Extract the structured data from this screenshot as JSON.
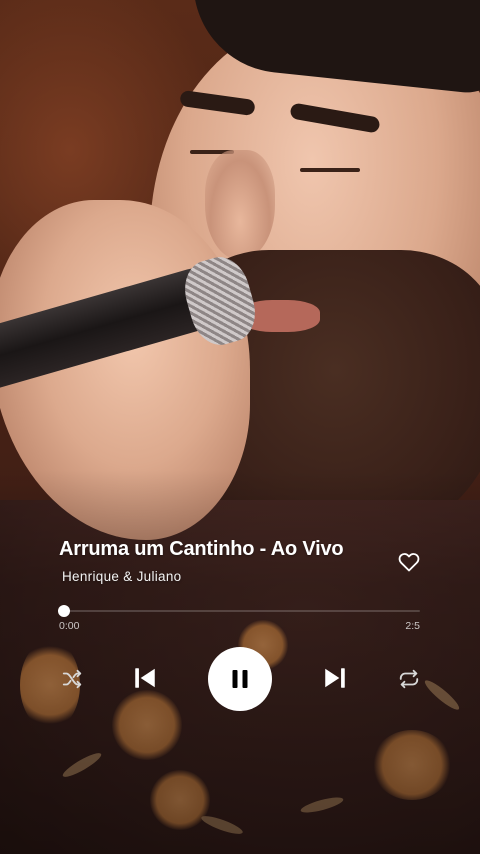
{
  "player": {
    "track_title": "Arruma um Cantinho - Ao Vivo",
    "artist": "Henrique & Juliano",
    "time_elapsed": "0:00",
    "time_total": "2:5",
    "progress": 0.0,
    "liked": false
  },
  "icons": {
    "like": "heart-outline-icon",
    "shuffle": "shuffle-icon",
    "previous": "skip-previous-icon",
    "play_pause": "pause-icon",
    "next": "skip-next-icon",
    "repeat": "repeat-icon"
  },
  "colors": {
    "foreground": "#ffffff",
    "control_dim": "#d8d8d8"
  }
}
